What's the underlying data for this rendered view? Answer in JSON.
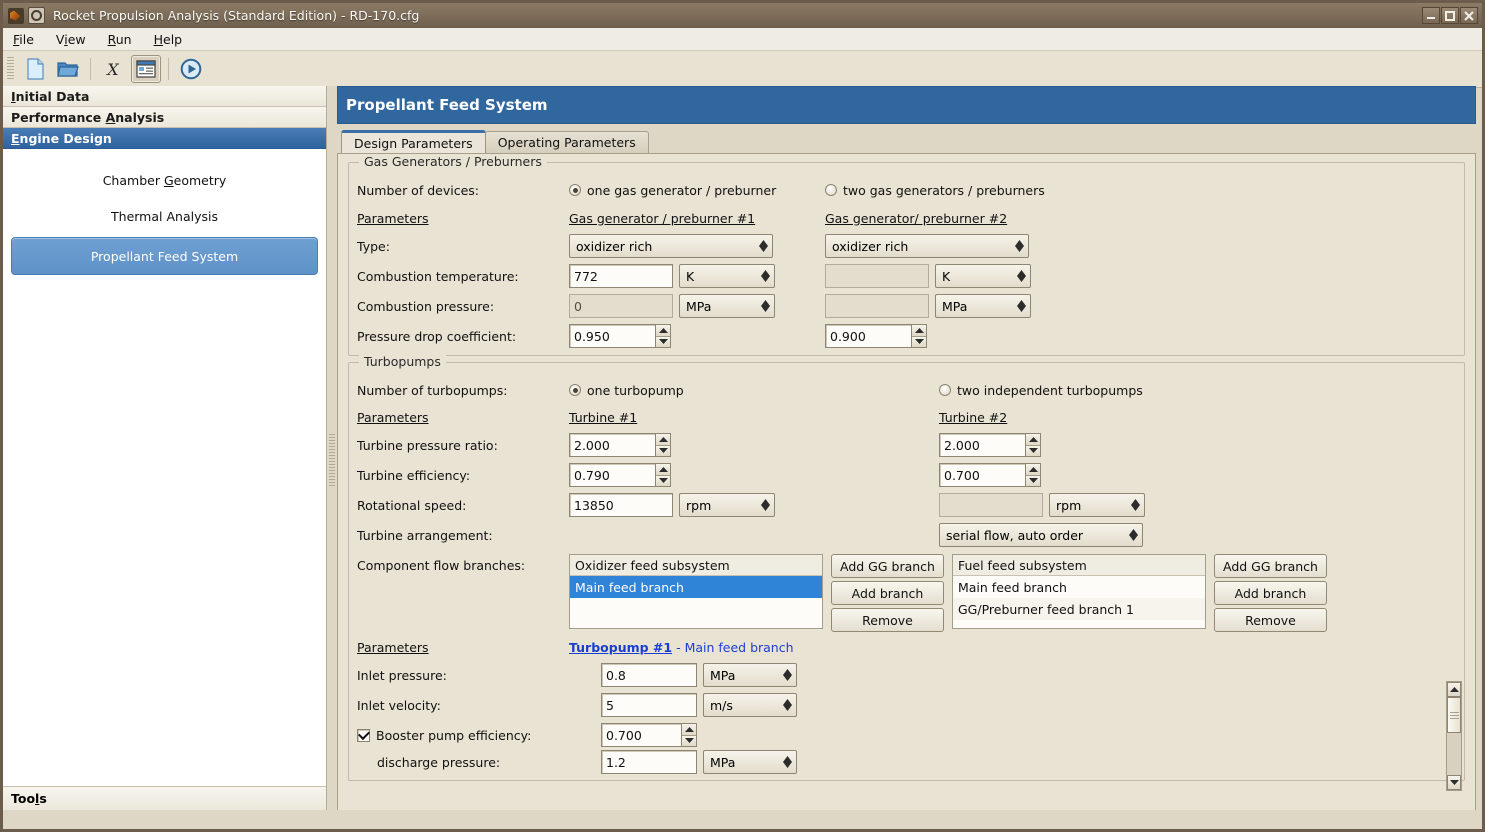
{
  "window": {
    "title": "Rocket Propulsion Analysis (Standard Edition) - RD-170.cfg",
    "minimize": "_",
    "maximize": "□",
    "close": "✕"
  },
  "menu": [
    {
      "label": "File",
      "accel": "F"
    },
    {
      "label": "View",
      "accel": "V"
    },
    {
      "label": "Run",
      "accel": "R"
    },
    {
      "label": "Help",
      "accel": "H"
    }
  ],
  "toolbar": {
    "items": [
      {
        "name": "new-file-icon",
        "tip": "New"
      },
      {
        "name": "open-folder-icon",
        "tip": "Open"
      },
      {
        "name": "export-x-icon",
        "tip": "X",
        "label": "X"
      },
      {
        "name": "properties-list-icon",
        "tip": "Details",
        "selected": true
      },
      {
        "name": "run-play-icon",
        "tip": "Run"
      }
    ]
  },
  "sidebar": {
    "sections": [
      {
        "label": "Initial Data",
        "accel": "I",
        "selected": false
      },
      {
        "label": "Performance Analysis",
        "accel": "A",
        "selected": false
      },
      {
        "label": "Engine Design",
        "accel": "E",
        "selected": true
      }
    ],
    "items": [
      {
        "label": "Chamber Geometry",
        "accel": "G",
        "selected": false
      },
      {
        "label": "Thermal Analysis",
        "accel": "",
        "selected": false
      },
      {
        "label": "Propellant Feed System",
        "accel": "",
        "selected": true
      }
    ],
    "footer": {
      "label": "Tools",
      "accel": "l"
    }
  },
  "panel": {
    "title": "Propellant Feed System",
    "tabs": [
      {
        "label": "Design Parameters",
        "active": true
      },
      {
        "label": "Operating Parameters",
        "active": false
      }
    ]
  },
  "gas_generators": {
    "group_title": "Gas Generators / Preburners",
    "number_label": "Number of devices:",
    "option_one": "one gas generator / preburner",
    "option_two": "two gas generators / preburners",
    "selected_option": "one",
    "parameters_label": "Parameters",
    "col1_header": "Gas generator / preburner #1",
    "col2_header": "Gas generator/ preburner #2",
    "rows": [
      {
        "label": "Type:",
        "v1": "oxidizer rich",
        "v2": "oxidizer rich",
        "unit1": "",
        "unit2": "",
        "kind": "combo"
      },
      {
        "label": "Combustion temperature:",
        "v1": "772",
        "v2": "",
        "unit1": "K",
        "unit2": "K",
        "kind": "text-unit"
      },
      {
        "label": "Combustion pressure:",
        "v1": "0",
        "v2": "",
        "unit1": "MPa",
        "unit2": "MPa",
        "kind": "text-unit"
      },
      {
        "label": "Pressure drop coefficient:",
        "v1": "0.950",
        "v2": "0.900",
        "unit1": "",
        "unit2": "",
        "kind": "spinner"
      }
    ]
  },
  "turbopumps": {
    "group_title": "Turbopumps",
    "number_label": "Number of turbopumps:",
    "option_one": "one turbopump",
    "option_two": "two independent turbopumps",
    "selected_option": "one",
    "parameters_label": "Parameters",
    "col1_header": "Turbine #1",
    "col2_header": "Turbine #2",
    "rows": [
      {
        "label": "Turbine pressure ratio:",
        "v1": "2.000",
        "v2": "2.000",
        "unit1": "",
        "unit2": "",
        "kind": "spinner"
      },
      {
        "label": "Turbine efficiency:",
        "v1": "0.790",
        "v2": "0.700",
        "unit1": "",
        "unit2": "",
        "kind": "spinner"
      },
      {
        "label": "Rotational speed:",
        "v1": "13850",
        "v2": "",
        "unit1": "rpm",
        "unit2": "rpm",
        "kind": "text-unit"
      }
    ],
    "arrangement_label": "Turbine arrangement:",
    "arrangement_value": "serial flow, auto order",
    "branches_label": "Component flow branches:",
    "oxidizer_list": {
      "header": "Oxidizer feed subsystem",
      "rows": [
        {
          "label": "Main feed branch",
          "selected": true
        }
      ]
    },
    "fuel_list": {
      "header": "Fuel feed subsystem",
      "rows": [
        {
          "label": "Main feed branch",
          "selected": false
        },
        {
          "label": "GG/Preburner feed branch 1",
          "selected": false
        }
      ]
    },
    "buttons": {
      "add_gg": "Add GG branch",
      "add_branch": "Add branch",
      "remove": "Remove"
    },
    "parameters_label2": "Parameters",
    "branch_link_bold": "Turbopump #1",
    "branch_link_rest": " - Main feed branch",
    "detail_rows": [
      {
        "label": "Inlet pressure:",
        "value": "0.8",
        "unit": "MPa",
        "kind": "text-unit",
        "indent": 0,
        "checkbox": null
      },
      {
        "label": "Inlet velocity:",
        "value": "5",
        "unit": "m/s",
        "kind": "text-unit",
        "indent": 0,
        "checkbox": null
      },
      {
        "label": "Booster pump efficiency:",
        "value": "0.700",
        "unit": "",
        "kind": "spinner",
        "indent": 0,
        "checkbox": true
      },
      {
        "label": "discharge pressure:",
        "value": "1.2",
        "unit": "MPa",
        "kind": "text-unit",
        "indent": 1,
        "checkbox": null
      }
    ]
  },
  "colors": {
    "accent_blue": "#31679f",
    "selection_blue": "#2f84d8",
    "sidebar_selected": "#5f92c8",
    "link_blue": "#1a3fd0",
    "window_bg": "#ded7c5",
    "panel_bg": "#e9e3d4"
  }
}
